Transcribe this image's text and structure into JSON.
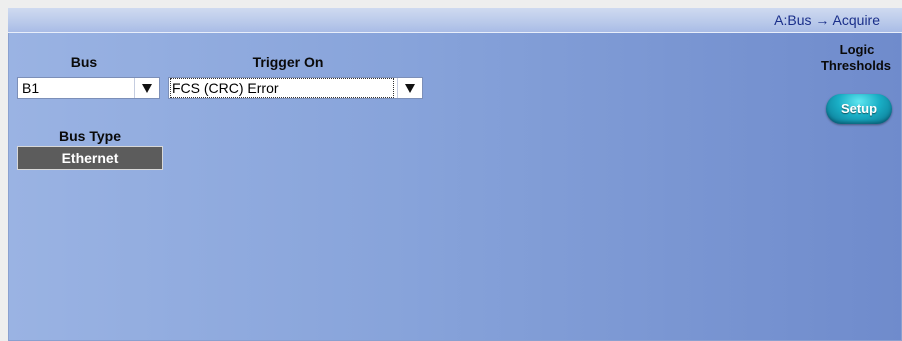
{
  "titlebar": {
    "breadcrumb": "A:Bus → Acquire"
  },
  "bus": {
    "label": "Bus",
    "value": "B1"
  },
  "trigger_on": {
    "label": "Trigger On",
    "value": "FCS (CRC) Error"
  },
  "bus_type": {
    "label": "Bus Type",
    "value": "Ethernet"
  },
  "logic_thresholds": {
    "label_line1": "Logic",
    "label_line2": "Thresholds",
    "button": "Setup"
  },
  "icons": {
    "dropdown": "triangle-down-icon"
  },
  "colors": {
    "panel": "#87a3da",
    "title_text": "#1a2f8a",
    "setup_button": "#19aec5",
    "bus_type_bg": "#5c5c5c"
  }
}
